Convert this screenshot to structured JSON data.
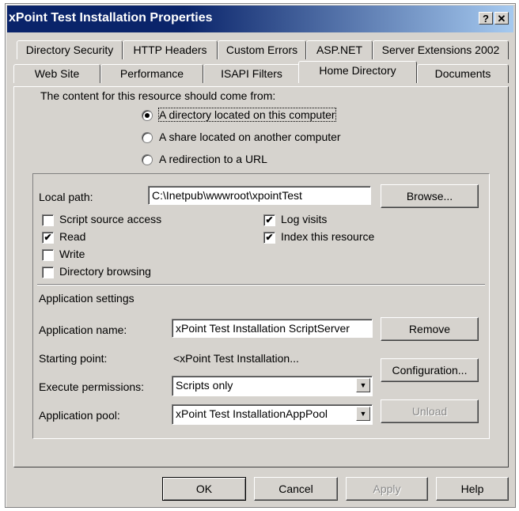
{
  "window": {
    "title": "xPoint Test Installation Properties",
    "help_glyph": "?",
    "close_glyph": "✕"
  },
  "tabs_top": [
    "Directory Security",
    "HTTP Headers",
    "Custom Errors",
    "ASP.NET",
    "Server Extensions 2002"
  ],
  "tabs_bottom": [
    "Web Site",
    "Performance",
    "ISAPI Filters",
    "Home Directory",
    "Documents"
  ],
  "active_tab": "Home Directory",
  "content_source": {
    "label": "The content for this resource should come from:",
    "options": [
      {
        "label": "A directory located on this computer",
        "selected": true
      },
      {
        "label": "A share located on another computer",
        "selected": false
      },
      {
        "label": "A redirection to a URL",
        "selected": false
      }
    ]
  },
  "local_path": {
    "label": "Local path:",
    "value": "C:\\Inetpub\\wwwroot\\xpointTest",
    "browse_label": "Browse..."
  },
  "checkboxes": {
    "script_source_access": {
      "label": "Script source access",
      "checked": false
    },
    "read": {
      "label": "Read",
      "checked": true
    },
    "write": {
      "label": "Write",
      "checked": false
    },
    "directory_browsing": {
      "label": "Directory browsing",
      "checked": false
    },
    "log_visits": {
      "label": "Log visits",
      "checked": true
    },
    "index_resource": {
      "label": "Index this resource",
      "checked": true
    }
  },
  "app_settings": {
    "heading": "Application settings",
    "name_label": "Application name:",
    "name_value": "xPoint Test Installation ScriptServer",
    "remove_label": "Remove",
    "starting_point_label": "Starting point:",
    "starting_point_value": "<xPoint Test Installation...",
    "configuration_label": "Configuration...",
    "exec_perm_label": "Execute permissions:",
    "exec_perm_value": "Scripts only",
    "pool_label": "Application pool:",
    "pool_value": "xPoint Test InstallationAppPool",
    "unload_label": "Unload"
  },
  "footer": {
    "ok": "OK",
    "cancel": "Cancel",
    "apply": "Apply",
    "help": "Help"
  },
  "check_glyph": "✔",
  "dropdown_glyph": "▼"
}
